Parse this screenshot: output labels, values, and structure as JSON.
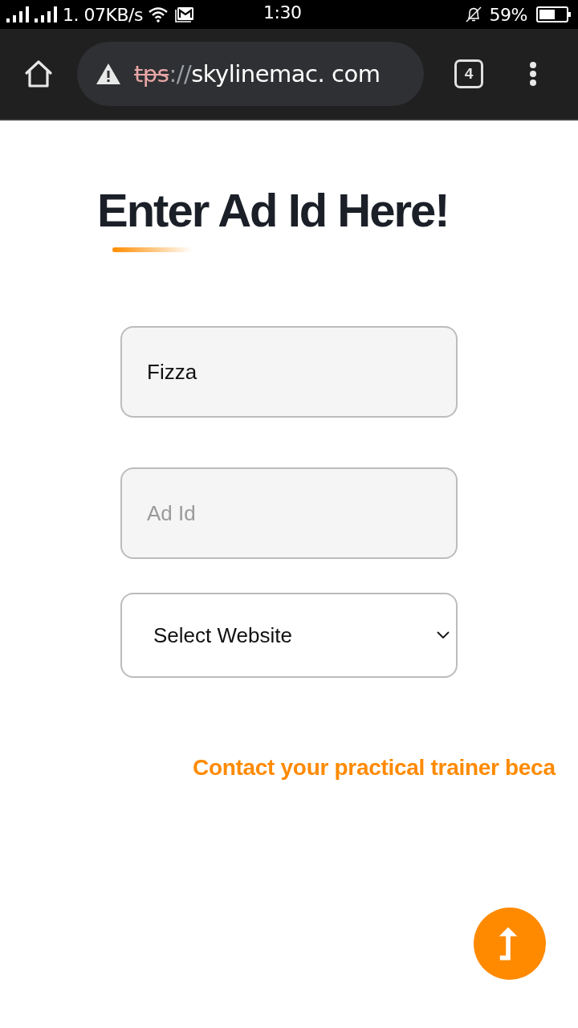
{
  "status_bar": {
    "network_speed": "1. 07KB/s",
    "time": "1:30",
    "battery": "59%"
  },
  "browser": {
    "url": {
      "scheme": "tps",
      "separator": "://",
      "host": "skylinemac. com",
      "insecure": true
    },
    "tab_count": "4"
  },
  "page": {
    "heading": "Enter Ad Id Here!",
    "fields": [
      {
        "kind": "text",
        "value": "Fizza"
      },
      {
        "kind": "text",
        "placeholder": "Ad Id"
      },
      {
        "kind": "select",
        "value": "Select Website"
      }
    ],
    "notice": "Contact your practical trainer beca"
  }
}
